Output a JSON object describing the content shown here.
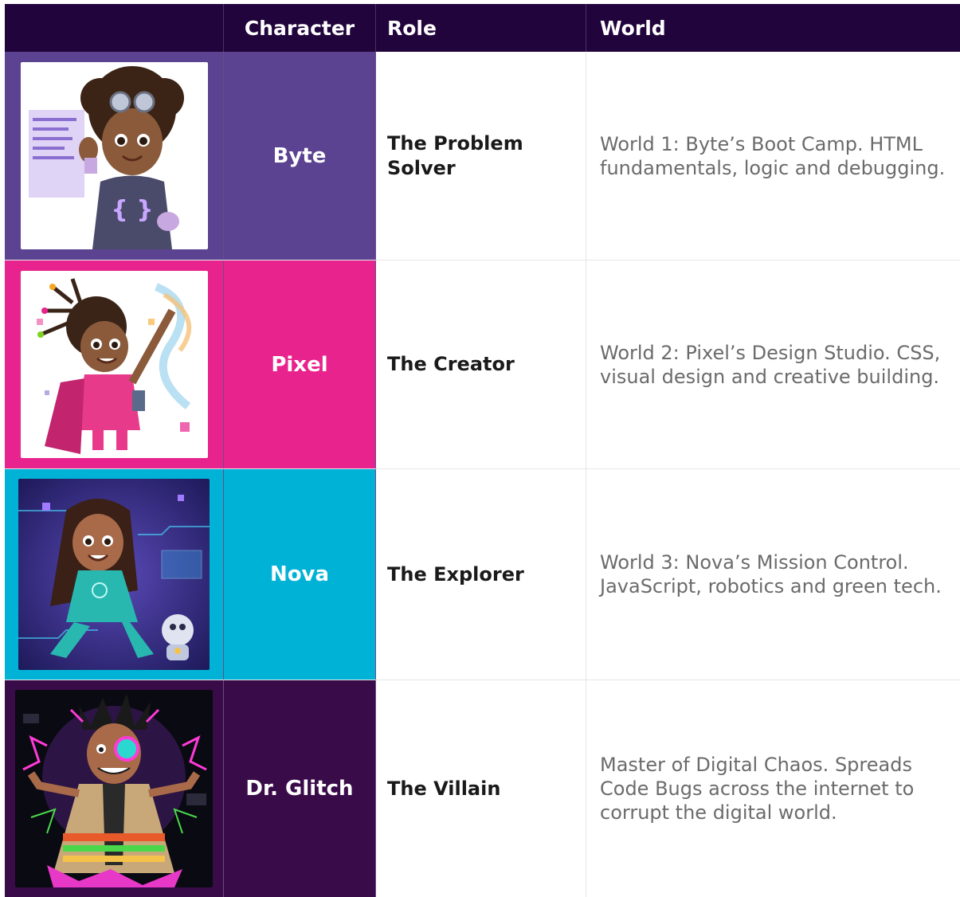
{
  "header": {
    "character": "Character",
    "role": "Role",
    "world": "World"
  },
  "rows": [
    {
      "name": "Byte",
      "role": "The Problem Solver",
      "world": "World 1: Byte’s Boot Camp. HTML fundamentals, logic and debugging.",
      "color": "#5c4392",
      "image": "byte-portrait"
    },
    {
      "name": "Pixel",
      "role": "The Creator",
      "world": "World 2: Pixel’s Design Studio. CSS, visual design and creative building.",
      "color": "#e8238d",
      "image": "pixel-portrait"
    },
    {
      "name": "Nova",
      "role": "The Explorer",
      "world": "World 3: Nova’s Mission Control. JavaScript, robotics and green tech.",
      "color": "#00b3d6",
      "image": "nova-portrait"
    },
    {
      "name": "Dr. Glitch",
      "role": "The Villain",
      "world": "Master of Digital Chaos. Spreads Code Bugs across the internet to corrupt the digital world.",
      "color": "#3a0b49",
      "image": "dr-glitch-portrait"
    }
  ]
}
